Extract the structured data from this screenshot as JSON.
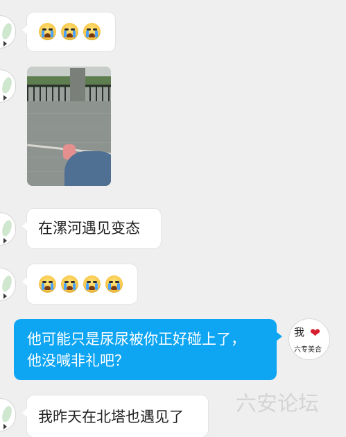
{
  "messages": [
    {
      "type": "emoji",
      "emoji": [
        "crying-face",
        "crying-face",
        "crying-face"
      ]
    },
    {
      "type": "image",
      "image_desc": "street-photo"
    },
    {
      "type": "text",
      "text": "在漯河遇见变态"
    },
    {
      "type": "emoji",
      "emoji": [
        "crying-face",
        "crying-face",
        "crying-face",
        "crying-face"
      ]
    },
    {
      "type": "text",
      "side": "right",
      "lines": [
        "他可能只是尿尿被你正好碰上了，",
        "他没喊非礼吧？"
      ]
    },
    {
      "type": "text",
      "text": "我昨天在北塔也遇见了"
    }
  ],
  "right_avatar": {
    "line1": "我",
    "heart": "❤",
    "line2": "六专美合"
  },
  "watermark": "六安论坛",
  "colors": {
    "background": "#efefef",
    "incoming_bubble": "#ffffff",
    "outgoing_bubble": "#0ea5f3"
  }
}
